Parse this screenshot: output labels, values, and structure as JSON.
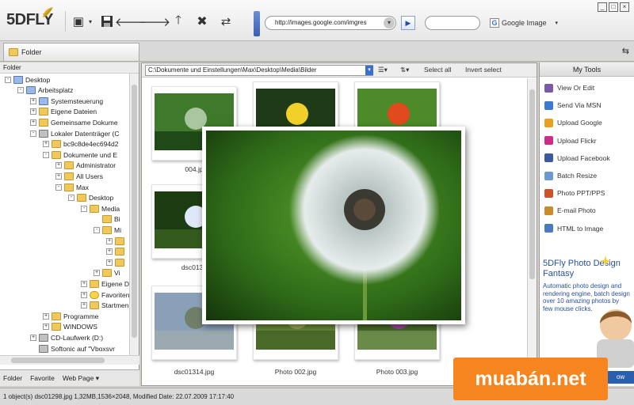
{
  "app": {
    "logo": "5DFLY"
  },
  "toolbar": {
    "address": "http://images.google.com/imgres",
    "search_engine": "Google Image"
  },
  "folder_tab": {
    "label": "Folder"
  },
  "left_pane": {
    "header": "Folder",
    "tree": [
      {
        "label": "Desktop",
        "icon": "pc"
      },
      {
        "label": "Arbeitsplatz",
        "icon": "pc"
      },
      {
        "label": "Systemsteuerung",
        "icon": "pc"
      },
      {
        "label": "Eigene Dateien",
        "icon": "folder"
      },
      {
        "label": "Gemeinsame Dokume",
        "icon": "folder"
      },
      {
        "label": "Lokaler Datenträger (C",
        "icon": "drive"
      },
      {
        "label": "bc9c8de4ec694d2",
        "icon": "folder"
      },
      {
        "label": "Dokumente und E",
        "icon": "folder"
      },
      {
        "label": "Administrator",
        "icon": "folder"
      },
      {
        "label": "All Users",
        "icon": "folder"
      },
      {
        "label": "Max",
        "icon": "folder"
      },
      {
        "label": "Desktop",
        "icon": "folder"
      },
      {
        "label": "Media",
        "icon": "folder"
      },
      {
        "label": "Bi",
        "icon": "folder"
      },
      {
        "label": "Mi",
        "icon": "folder"
      },
      {
        "label": "",
        "icon": "folder"
      },
      {
        "label": "",
        "icon": "folder"
      },
      {
        "label": "",
        "icon": "folder"
      },
      {
        "label": "Vi",
        "icon": "folder"
      },
      {
        "label": "Eigene Do",
        "icon": "folder"
      },
      {
        "label": "Favoriten",
        "icon": "star"
      },
      {
        "label": "Startmenü",
        "icon": "folder"
      },
      {
        "label": "Programme",
        "icon": "folder"
      },
      {
        "label": "WINDOWS",
        "icon": "folder"
      },
      {
        "label": "CD-Laufwerk (D:)",
        "icon": "drive"
      },
      {
        "label": "Softonic auf \"Vboxsvr",
        "icon": "drive"
      }
    ],
    "tabs": [
      "Folder",
      "Favorite",
      "Web Page ▾"
    ]
  },
  "center": {
    "path": "C:\\Dokumente und Einstellungen\\Max\\Desktop\\Media\\Bilder",
    "select_all": "Select all",
    "invert_select": "Invert select",
    "thumbnails": [
      {
        "caption": "004.jp",
        "colors": [
          "#3f7a2c",
          "#a9c6a0",
          "#1f4a18"
        ]
      },
      {
        "caption": "",
        "colors": [
          "#1e3a16",
          "#f2d02a",
          "#3a6b1c"
        ]
      },
      {
        "caption": "",
        "colors": [
          "#4c8a2a",
          "#e04a1c",
          "#2c5a16"
        ]
      },
      {
        "caption": "dsc0130",
        "colors": [
          "#1c3c12",
          "#dfe8f8",
          "#345a1e"
        ]
      },
      {
        "caption": "dsc01314.jpg",
        "colors": [
          "#8aa0b8",
          "#6f7f6a",
          "#9aa8b0"
        ]
      },
      {
        "caption": "Photo 002.jpg",
        "colors": [
          "#6a8a3a",
          "#9aaa5a",
          "#4a6a2a"
        ]
      },
      {
        "caption": "Photo 003.jpg",
        "colors": [
          "#4a6a2a",
          "#a04aa0",
          "#6a8a4a"
        ]
      }
    ]
  },
  "right_pane": {
    "title": "My Tools",
    "tools": [
      {
        "label": "View Or Edit",
        "color": "#7a5aa8"
      },
      {
        "label": "Send Via MSN",
        "color": "#3a7ad0"
      },
      {
        "label": "Upload Google",
        "color": "#e8a020"
      },
      {
        "label": "Upload Flickr",
        "color": "#d02a8a"
      },
      {
        "label": "Upload Facebook",
        "color": "#3a5aa0"
      },
      {
        "label": "Batch Resize",
        "color": "#6a9ad0"
      },
      {
        "label": "Photo PPT/PPS",
        "color": "#d0502a"
      },
      {
        "label": "E-mail Photo",
        "color": "#c88a2a"
      },
      {
        "label": "HTML to Image",
        "color": "#4a7ac0"
      }
    ],
    "ad": {
      "title": "5DFly Photo Design Fantasy",
      "text": "Automatic photo design and rendering engine, batch design over 10 amazing photos by few mouse clicks.",
      "button": "ow"
    }
  },
  "status": "1 object(s)  dsc01298.jpg  1,32MB,1536×2048, Modified Date: 22.07.2009 17:17:40",
  "watermark": "muabán.net"
}
